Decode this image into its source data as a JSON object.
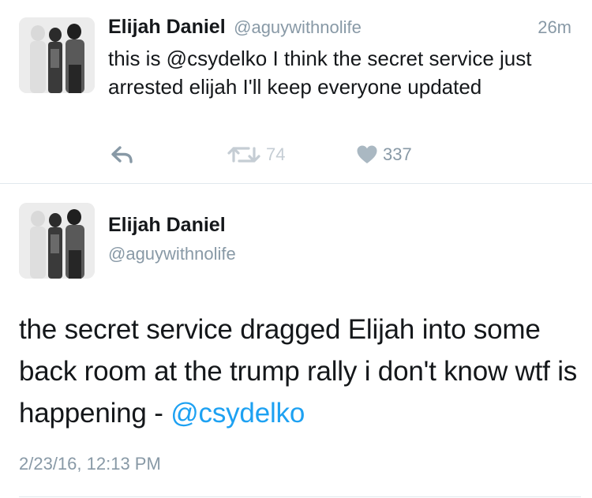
{
  "tweet1": {
    "display_name": "Elijah Daniel",
    "handle": "@aguywithnolife",
    "time_ago": "26m",
    "text": "this is @csydelko I think the secret service just arrested elijah I'll keep everyone updated",
    "actions": {
      "reply_icon": "reply-icon",
      "retweet_icon": "retweet-icon",
      "like_icon": "heart-icon",
      "retweets": "74",
      "likes": "337"
    }
  },
  "tweet2": {
    "display_name": "Elijah Daniel",
    "handle": "@aguywithnolife",
    "text_main": "the secret service dragged Elijah into some back room at the trump rally i don't know wtf is happening - ",
    "mention": "@csydelko",
    "timestamp": "2/23/16, 12:13 PM"
  },
  "colors": {
    "text": "#14171a",
    "secondary": "#8899a6",
    "link": "#1da1f2",
    "divider": "#e1e8ed"
  }
}
